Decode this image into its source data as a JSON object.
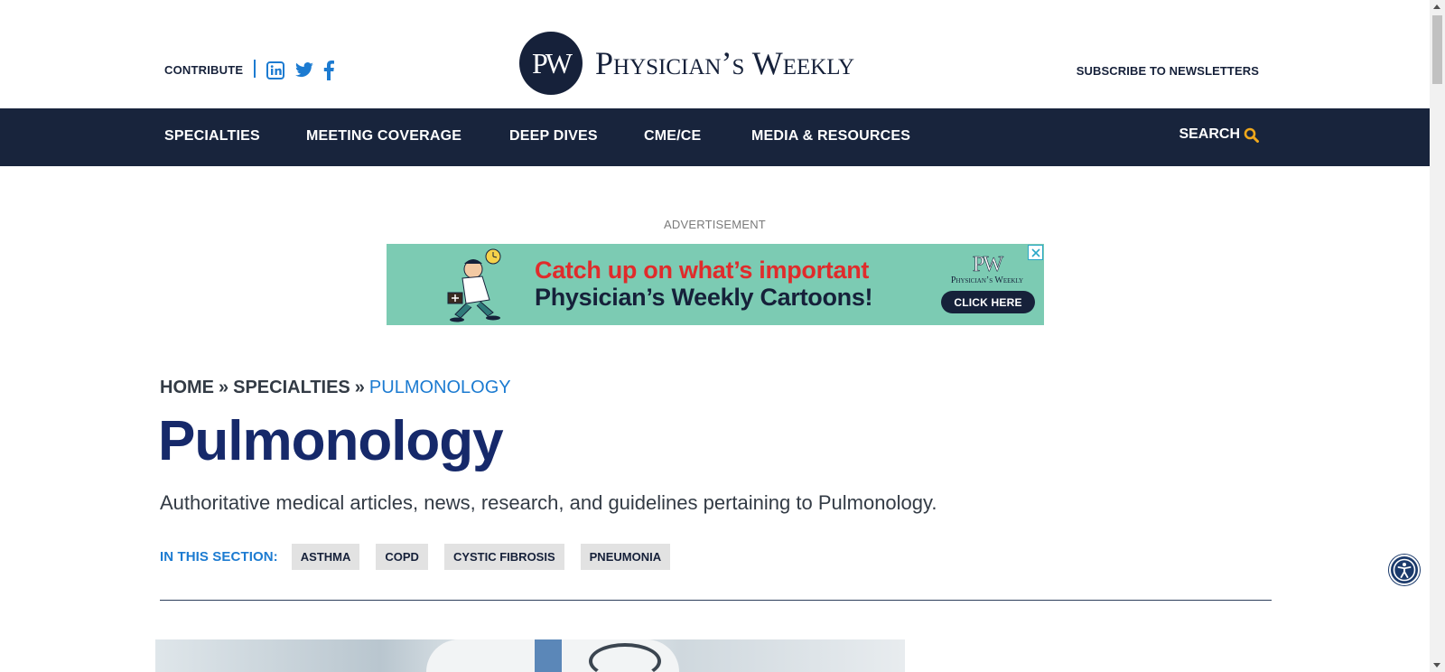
{
  "header": {
    "contribute_label": "CONTRIBUTE",
    "social": [
      "linkedin-icon",
      "twitter-icon",
      "facebook-icon"
    ],
    "logo_monogram": "PW",
    "logo_text": "Physician’s Weekly",
    "subscribe_label": "SUBSCRIBE TO NEWSLETTERS"
  },
  "nav": {
    "items": [
      {
        "label": "SPECIALTIES"
      },
      {
        "label": "MEETING COVERAGE"
      },
      {
        "label": "DEEP DIVES"
      },
      {
        "label": "CME/CE"
      },
      {
        "label": "MEDIA & RESOURCES"
      }
    ],
    "search_label": "SEARCH"
  },
  "ad": {
    "label": "ADVERTISEMENT",
    "headline_1": "Catch up on what’s important",
    "headline_2": "Physician’s Weekly Cartoons!",
    "brand_monogram": "PW",
    "brand_name": "Physician’s Weekly",
    "cta": "CLICK HERE"
  },
  "breadcrumb": {
    "home": "HOME",
    "sep": "»",
    "specialties": "SPECIALTIES",
    "current": "PULMONOLOGY"
  },
  "page": {
    "title": "Pulmonology",
    "description": "Authoritative medical articles, news, research, and guidelines pertaining to Pulmonology."
  },
  "section": {
    "label": "IN THIS SECTION:",
    "chips": [
      {
        "label": "ASTHMA"
      },
      {
        "label": "COPD"
      },
      {
        "label": "CYSTIC FIBROSIS"
      },
      {
        "label": "PNEUMONIA"
      }
    ]
  },
  "colors": {
    "navy": "#18243c",
    "accent_blue": "#1c7bd1",
    "title_blue": "#16296a",
    "search_icon": "#f0a81c",
    "ad_background": "#7ccbb3",
    "ad_red": "#e02b2b"
  }
}
